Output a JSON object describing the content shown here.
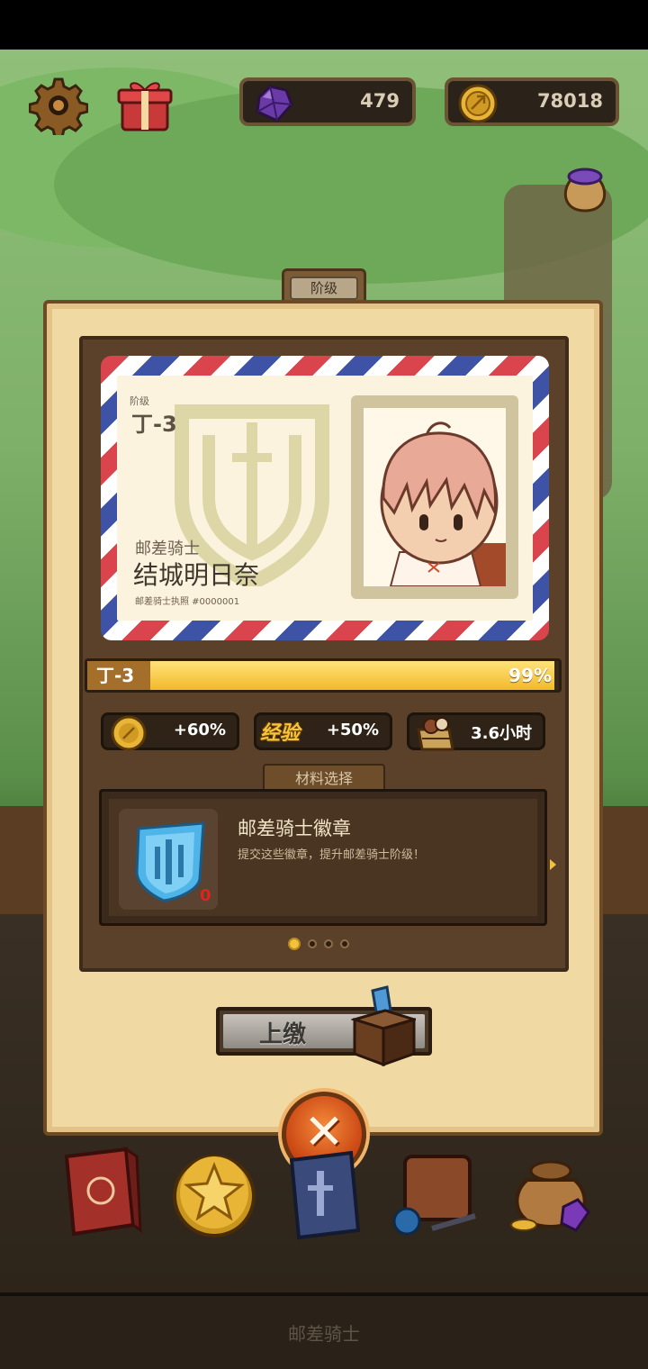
{
  "hud": {
    "gems": "479",
    "coins": "78018"
  },
  "panel": {
    "tab_label": "阶级"
  },
  "card": {
    "rank_label": "阶级",
    "rank_value": "丁-3",
    "role": "邮差骑士",
    "name": "结城明日奈",
    "license": "邮差骑士执照 #0000001"
  },
  "progress": {
    "level": "丁-3",
    "percent_label": "99%",
    "percent": 0.99
  },
  "stats": {
    "coin_bonus": "+60%",
    "exp_label": "经验",
    "exp_bonus": "+50%",
    "time": "3.6小时"
  },
  "materials": {
    "tab_label": "材料选择",
    "item_title": "邮差骑士徽章",
    "item_desc": "提交这些徽章，提升邮差骑士阶级！",
    "item_count": "0",
    "page_count": 4,
    "active_page": 0
  },
  "actions": {
    "submit_label": "上缴"
  },
  "footer": {
    "label": "邮差骑士"
  },
  "colors": {
    "panel": "#f1d9a4",
    "progress": "#f2b92a",
    "close": "#c94412"
  }
}
